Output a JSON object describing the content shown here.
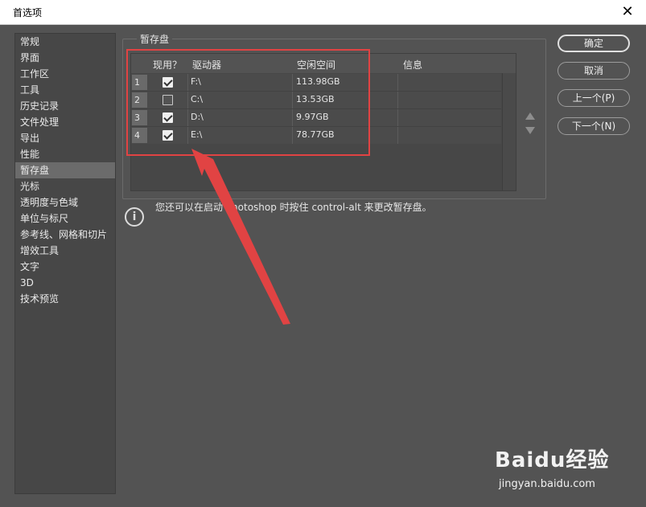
{
  "window": {
    "title": "首选项",
    "close_glyph": "✕"
  },
  "sidebar": {
    "items": [
      {
        "label": "常规"
      },
      {
        "label": "界面"
      },
      {
        "label": "工作区"
      },
      {
        "label": "工具"
      },
      {
        "label": "历史记录"
      },
      {
        "label": "文件处理"
      },
      {
        "label": "导出"
      },
      {
        "label": "性能"
      },
      {
        "label": "暂存盘",
        "selected": true
      },
      {
        "label": "光标"
      },
      {
        "label": "透明度与色域"
      },
      {
        "label": "单位与标尺"
      },
      {
        "label": "参考线、网格和切片"
      },
      {
        "label": "增效工具"
      },
      {
        "label": "文字"
      },
      {
        "label": "3D"
      },
      {
        "label": "技术预览"
      }
    ]
  },
  "scratch": {
    "group_title": "暂存盘",
    "columns": {
      "active": "现用？",
      "drive": "驱动器",
      "free": "空闲空间",
      "info": "信息"
    },
    "rows": [
      {
        "index": "1",
        "active": true,
        "drive": "F:\\",
        "free": "113.98GB",
        "info": ""
      },
      {
        "index": "2",
        "active": false,
        "drive": "C:\\",
        "free": "13.53GB",
        "info": ""
      },
      {
        "index": "3",
        "active": true,
        "drive": "D:\\",
        "free": "9.97GB",
        "info": ""
      },
      {
        "index": "4",
        "active": true,
        "drive": "E:\\",
        "free": "78.77GB",
        "info": ""
      }
    ]
  },
  "info": {
    "icon": "info-icon",
    "text": "您还可以在启动 Photoshop 时按住 control-alt 来更改暂存盘。"
  },
  "buttons": {
    "ok": "确定",
    "cancel": "取消",
    "prev": "上一个(P)",
    "next": "下一个(N)"
  },
  "watermark": {
    "logo": "Baidu经验",
    "url": "jingyan.baidu.com"
  },
  "colors": {
    "annotation": "#e14343",
    "panel": "#535353"
  }
}
